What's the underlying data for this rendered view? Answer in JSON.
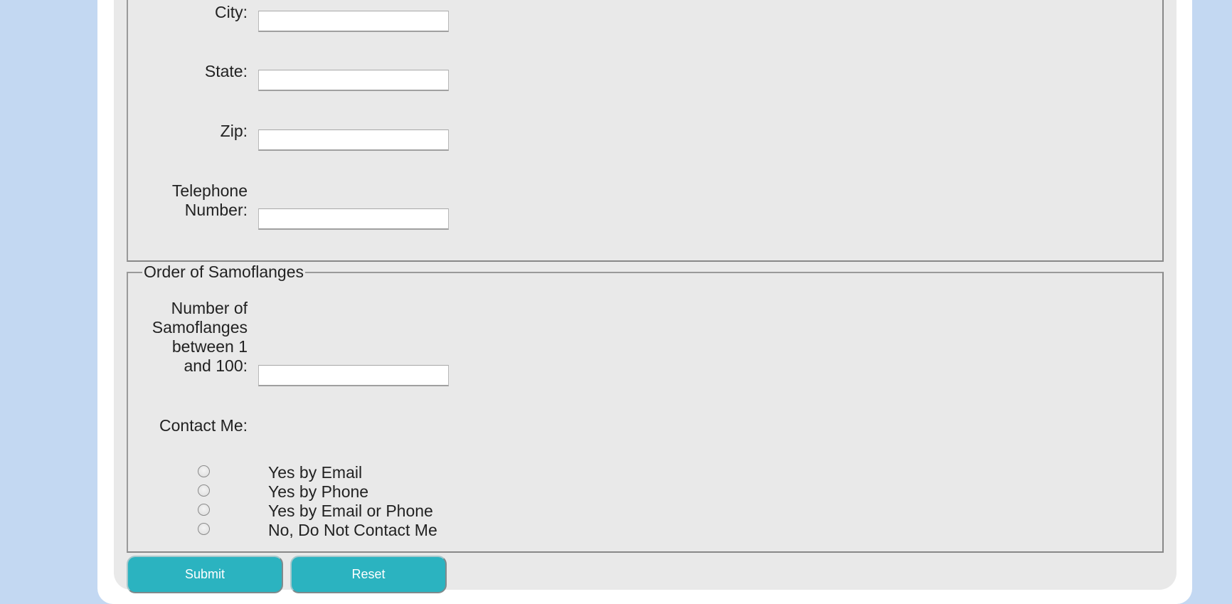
{
  "address_section": {
    "fields": [
      {
        "label": "City:",
        "value": ""
      },
      {
        "label": "State:",
        "value": ""
      },
      {
        "label": "Zip:",
        "value": ""
      },
      {
        "label_line1": "Telephone",
        "label_line2": "Number:",
        "value": ""
      }
    ]
  },
  "order_section": {
    "legend": "Order of Samoflanges",
    "quantity": {
      "label_lines": [
        "Number of",
        "Samoflanges",
        "between 1",
        "and 100:"
      ],
      "value": ""
    },
    "contact": {
      "label": "Contact Me:",
      "options": [
        {
          "label": "Yes by Email",
          "selected": false
        },
        {
          "label": "Yes by Phone",
          "selected": false
        },
        {
          "label": "Yes by Email or Phone",
          "selected": false
        },
        {
          "label": "No, Do Not Contact Me",
          "selected": false
        }
      ]
    }
  },
  "buttons": {
    "submit_label": "Submit",
    "reset_label": "Reset"
  },
  "colors": {
    "background": "#c3d8f2",
    "panel": "#e9e9e9",
    "button": "#2bb3c0"
  }
}
